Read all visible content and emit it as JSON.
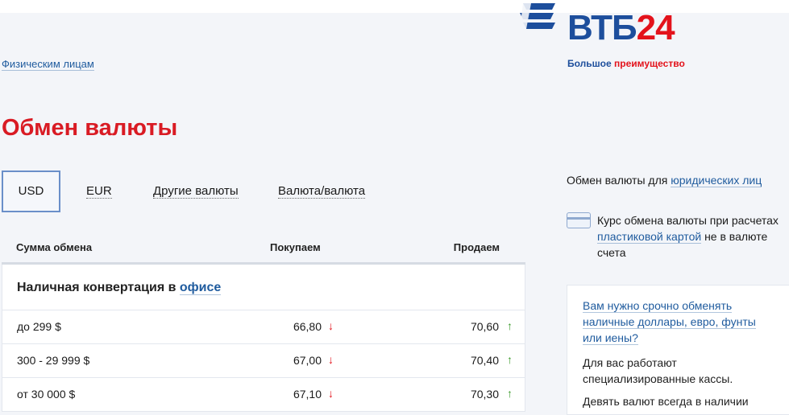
{
  "breadcrumb": {
    "label": "Физическим лицам"
  },
  "logo": {
    "brand_left": "ВТБ",
    "brand_right": "24",
    "slogan_a": "Большое",
    "slogan_b": "преимущество"
  },
  "page": {
    "title": "Обмен валюты"
  },
  "tabs": [
    {
      "label": "USD",
      "active": true
    },
    {
      "label": "EUR"
    },
    {
      "label": "Другие валюты"
    },
    {
      "label": "Валюта/валюта"
    }
  ],
  "table": {
    "headers": {
      "amount": "Сумма обмена",
      "buy": "Покупаем",
      "sell": "Продаем"
    },
    "section": {
      "title_prefix": "Наличная конвертация в",
      "title_link": "офисе"
    },
    "rows": [
      {
        "amount": "до 299 $",
        "buy": "66,80",
        "buy_trend": "down",
        "sell": "70,60",
        "sell_trend": "up"
      },
      {
        "amount": "300 - 29 999 $",
        "buy": "67,00",
        "buy_trend": "down",
        "sell": "70,40",
        "sell_trend": "up"
      },
      {
        "amount": "от 30 000 $",
        "buy": "67,10",
        "buy_trend": "down",
        "sell": "70,30",
        "sell_trend": "up"
      }
    ],
    "arrows": {
      "down": "↓",
      "up": "↑",
      "down_color": "#e3121b",
      "up_color": "#3a9a2a"
    }
  },
  "sidebar": {
    "legal_prefix": "Обмен валюты для",
    "legal_link": "юридических лиц",
    "card_icon": "bank-card-icon",
    "card_text_a": "Курс обмена валюты при расчетах",
    "card_link": "пластиковой картой",
    "card_text_b": "не в валюте счета",
    "promo_link": "Вам нужно срочно обменять наличные доллары, евро, фунты или иены?",
    "promo_text": "Для вас работают специализированные кассы.",
    "promo_text2": "Девять валют всегда в наличии"
  },
  "colors": {
    "accent_red": "#d91b24",
    "brand_blue": "#1d4e9c",
    "link": "#1f5b9e"
  }
}
